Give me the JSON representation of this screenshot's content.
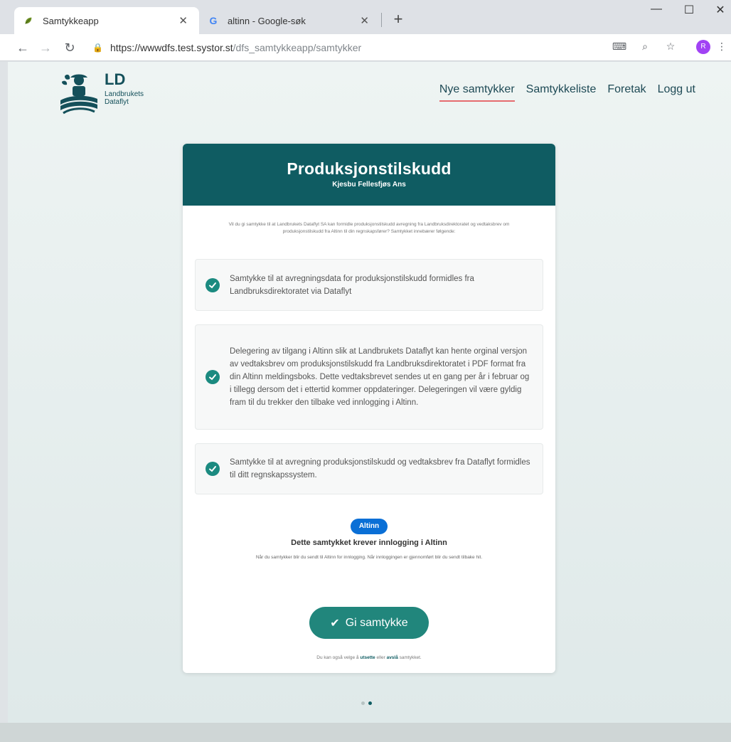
{
  "browser": {
    "tabs": [
      {
        "title": "Samtykkeapp",
        "icon": "leaf-icon"
      },
      {
        "title": "altinn - Google-søk",
        "icon": "google-icon"
      }
    ],
    "url_host": "https://wwwdfs.test.systor.st",
    "url_path": "/dfs_samtykkeapp/samtykker",
    "profile_initial": "R"
  },
  "logo": {
    "title": "LD",
    "subtitle_line1": "Landbrukets",
    "subtitle_line2": "Dataflyt"
  },
  "nav": {
    "items": [
      "Nye samtykker",
      "Samtykkeliste",
      "Foretak",
      "Logg ut"
    ],
    "active_index": 0
  },
  "card": {
    "title": "Produksjonstilskudd",
    "subtitle": "Kjesbu Fellesfjøs Ans",
    "intro": "Vil du gi samtykke til at Landbrukets Dataflyt SA kan formidle produksjonstilskudd avregning fra Landbruksdirektoratet og vedtaksbrev om produksjonstilskudd fra Altinn til din regnskapsfører? Samtykket innebærer følgende:",
    "items": [
      "Samtykke til at avregningsdata for produksjonstilskudd formidles fra Landbruksdirektoratet via Dataflyt",
      "Delegering av tilgang i Altinn slik at Landbrukets Dataflyt kan hente orginal versjon av vedtaksbrev om produksjonstilskudd fra Landbruksdirektoratet i PDF format fra din Altinn meldingsboks. Dette vedtaksbrevet sendes ut en gang per år i februar og i tillegg dersom det i ettertid kommer oppdateringer. Delegeringen vil være gyldig fram til du trekker den tilbake ved innlogging i Altinn.",
      "Samtykke til at avregning produksjonstilskudd og vedtaksbrev fra Dataflyt formidles til ditt regnskapssystem."
    ],
    "altinn_badge": "Altinn",
    "altinn_heading": "Dette samtykket krever innlogging i Altinn",
    "altinn_note": "Når du samtykker blir du sendt til Altinn for innlogging. Når innloggingen er gjennomført blir du sendt tilbake hit.",
    "consent_button": "Gi samtykke",
    "footer_prefix": "Du kan også velge å",
    "footer_link1": "utsette",
    "footer_middle": "eller",
    "footer_link2": "avslå",
    "footer_suffix": "samtykket."
  },
  "colors": {
    "header": "#0f5c62",
    "accent": "#21867c",
    "altinn": "#0a6fd6",
    "nav_underline": "#e56b6f"
  }
}
